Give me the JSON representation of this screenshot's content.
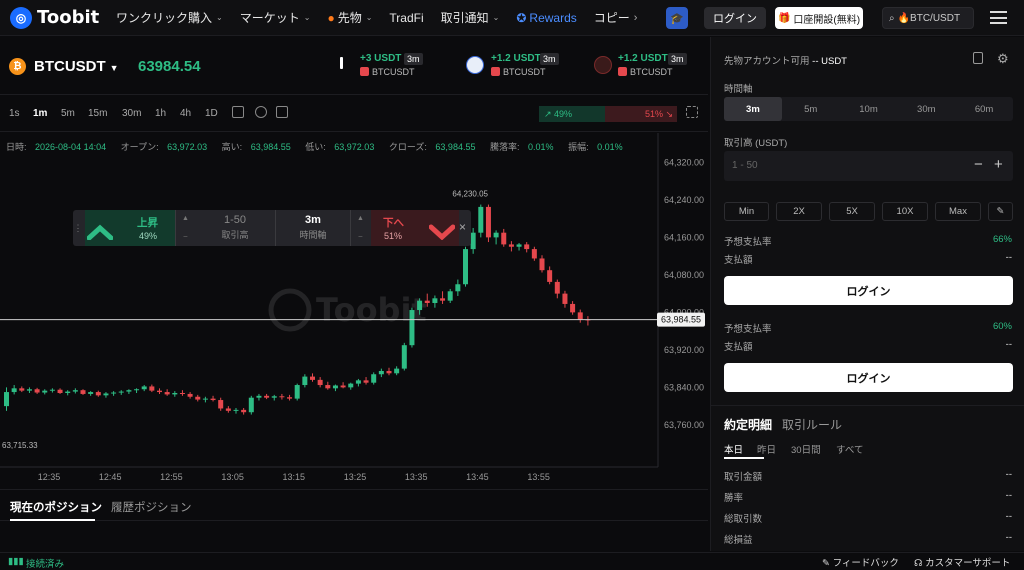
{
  "nav": {
    "logo": "Toobit",
    "items": [
      "ワンクリック購入",
      "マーケット",
      "先物",
      "TradFi",
      "取引通知",
      "Rewards",
      "コピー"
    ],
    "login": "ログイン",
    "open_account": "口座開設(無料)",
    "search": "🔥BTC/USDT"
  },
  "ticker": {
    "symbol": "BTCUSDT",
    "price": "63984.54",
    "trades": [
      {
        "amount": "+3 USDT",
        "dur": "3m",
        "sym": "BTCUSDT"
      },
      {
        "amount": "+1.2 USDT",
        "dur": "3m",
        "sym": "BTCUSDT"
      },
      {
        "amount": "+1.2 USDT",
        "dur": "3m",
        "sym": "BTCUSDT"
      }
    ]
  },
  "toolbar": {
    "timeframes": [
      "1s",
      "1m",
      "5m",
      "15m",
      "30m",
      "1h",
      "4h",
      "1D"
    ],
    "active": "1m",
    "up_pct": "↗ 49%",
    "down_pct": "51% ↘"
  },
  "info": {
    "date_label": "日時:",
    "date": "2026-08-04 14:04",
    "open_label": "オープン:",
    "open": "63,972.03",
    "high_label": "高い:",
    "high": "63,984.55",
    "low_label": "低い:",
    "low": "63,972.03",
    "close_label": "クローズ:",
    "close": "63,984.55",
    "change_label": "騰落率:",
    "change": "0.01%",
    "amp_label": "振幅:",
    "amp": "0.01%"
  },
  "chart_data": {
    "type": "candlestick",
    "y_ticks": [
      "64,320.00",
      "64,240.00",
      "64,160.00",
      "64,080.00",
      "64,000.00",
      "63,920.00",
      "63,840.00",
      "63,760.00"
    ],
    "x_ticks": [
      "12:35",
      "12:45",
      "12:55",
      "13:05",
      "13:15",
      "13:25",
      "13:35",
      "13:45",
      "13:55"
    ],
    "ylim": [
      63700,
      64340
    ],
    "current_price": "63,984.55",
    "high_annotation": "64,230.05",
    "low_annotation": "63,715.33",
    "watermark": "Toobit",
    "candles": [
      [
        63800,
        63840,
        63790,
        63830
      ],
      [
        63830,
        63845,
        63825,
        63838
      ],
      [
        63838,
        63842,
        63830,
        63833
      ],
      [
        63833,
        63840,
        63828,
        63836
      ],
      [
        63836,
        63839,
        63826,
        63829
      ],
      [
        63829,
        63836,
        63825,
        63833
      ],
      [
        63833,
        63838,
        63829,
        63835
      ],
      [
        63835,
        63838,
        63826,
        63828
      ],
      [
        63828,
        63834,
        63823,
        63831
      ],
      [
        63831,
        63838,
        63827,
        63834
      ],
      [
        63834,
        63836,
        63824,
        63826
      ],
      [
        63826,
        63832,
        63822,
        63830
      ],
      [
        63830,
        63833,
        63820,
        63823
      ],
      [
        63823,
        63830,
        63818,
        63827
      ],
      [
        63827,
        63832,
        63822,
        63829
      ],
      [
        63829,
        63834,
        63824,
        63831
      ],
      [
        63831,
        63836,
        63826,
        63834
      ],
      [
        63834,
        63838,
        63828,
        63836
      ],
      [
        63836,
        63845,
        63832,
        63842
      ],
      [
        63842,
        63846,
        63830,
        63833
      ],
      [
        63833,
        63838,
        63826,
        63830
      ],
      [
        63830,
        63836,
        63822,
        63825
      ],
      [
        63825,
        63832,
        63820,
        63828
      ],
      [
        63828,
        63834,
        63822,
        63826
      ],
      [
        63826,
        63830,
        63816,
        63820
      ],
      [
        63820,
        63824,
        63810,
        63814
      ],
      [
        63814,
        63820,
        63808,
        63816
      ],
      [
        63816,
        63822,
        63810,
        63813
      ],
      [
        63813,
        63818,
        63790,
        63795
      ],
      [
        63795,
        63800,
        63786,
        63790
      ],
      [
        63790,
        63796,
        63784,
        63792
      ],
      [
        63792,
        63796,
        63782,
        63787
      ],
      [
        63787,
        63822,
        63782,
        63818
      ],
      [
        63818,
        63826,
        63812,
        63822
      ],
      [
        63822,
        63826,
        63815,
        63818
      ],
      [
        63818,
        63824,
        63812,
        63821
      ],
      [
        63821,
        63826,
        63814,
        63819
      ],
      [
        63819,
        63824,
        63812,
        63816
      ],
      [
        63816,
        63848,
        63812,
        63845
      ],
      [
        63845,
        63868,
        63840,
        63863
      ],
      [
        63863,
        63870,
        63852,
        63856
      ],
      [
        63856,
        63862,
        63840,
        63845
      ],
      [
        63845,
        63852,
        63835,
        63838
      ],
      [
        63838,
        63846,
        63832,
        63844
      ],
      [
        63844,
        63851,
        63838,
        63840
      ],
      [
        63840,
        63850,
        63835,
        63848
      ],
      [
        63848,
        63858,
        63842,
        63855
      ],
      [
        63855,
        63862,
        63846,
        63850
      ],
      [
        63850,
        63872,
        63846,
        63868
      ],
      [
        63868,
        63880,
        63862,
        63875
      ],
      [
        63875,
        63882,
        63866,
        63870
      ],
      [
        63870,
        63885,
        63866,
        63880
      ],
      [
        63880,
        63935,
        63876,
        63930
      ],
      [
        63930,
        64010,
        63925,
        64005
      ],
      [
        64005,
        64030,
        63995,
        64025
      ],
      [
        64025,
        64040,
        64012,
        64020
      ],
      [
        64020,
        64036,
        64010,
        64030
      ],
      [
        64030,
        64045,
        64018,
        64025
      ],
      [
        64025,
        64050,
        64020,
        64045
      ],
      [
        64045,
        64070,
        64035,
        64060
      ],
      [
        64060,
        64140,
        64055,
        64135
      ],
      [
        64135,
        64180,
        64125,
        64170
      ],
      [
        64170,
        64230,
        64160,
        64225
      ],
      [
        64225,
        64230,
        64150,
        64160
      ],
      [
        64160,
        64175,
        64145,
        64170
      ],
      [
        64170,
        64178,
        64140,
        64145
      ],
      [
        64145,
        64152,
        64130,
        64140
      ],
      [
        64140,
        64148,
        64132,
        64145
      ],
      [
        64145,
        64150,
        64128,
        64135
      ],
      [
        64135,
        64140,
        64110,
        64115
      ],
      [
        64115,
        64122,
        64085,
        64090
      ],
      [
        64090,
        64098,
        64060,
        64065
      ],
      [
        64065,
        64070,
        64030,
        64040
      ],
      [
        64040,
        64046,
        64010,
        64018
      ],
      [
        64018,
        64024,
        63995,
        64000
      ],
      [
        64000,
        64006,
        63978,
        63985
      ],
      [
        63985,
        63992,
        63972,
        63984
      ]
    ]
  },
  "bet": {
    "up_label": "上昇",
    "up_pct": "49%",
    "amount_value": "1-50",
    "amount_label": "取引高",
    "time_value": "3m",
    "time_label": "時間軸",
    "down_label": "下へ",
    "down_pct": "51%"
  },
  "bottom": {
    "tab_current": "現在のポジション",
    "tab_history": "履歴ポジション"
  },
  "status": {
    "connected": "接続済み",
    "feedback": "フィードバック",
    "support": "カスタマーサポート"
  },
  "panel": {
    "account_label": "先物アカウント可用",
    "account_value": "-- USDT",
    "timeframe_label": "時間軸",
    "timeframes": [
      "3m",
      "5m",
      "10m",
      "30m",
      "60m"
    ],
    "amount_label": "取引高 (USDT)",
    "amount_placeholder": "1 - 50",
    "levels": [
      "Min",
      "2X",
      "5X",
      "10X",
      "Max"
    ],
    "up_rate_label": "予想支払率",
    "up_rate": "66%",
    "up_pay_label": "支払額",
    "up_pay": "--",
    "login": "ログイン",
    "down_rate_label": "予想支払率",
    "down_rate": "60%",
    "down_pay_label": "支払額",
    "down_pay": "--",
    "tab_detail": "約定明細",
    "tab_rules": "取引ルール",
    "periods": [
      "本日",
      "昨日",
      "30日間",
      "すべて"
    ],
    "stats": [
      {
        "label": "取引金額",
        "value": "--"
      },
      {
        "label": "勝率",
        "value": "--"
      },
      {
        "label": "総取引数",
        "value": "--"
      },
      {
        "label": "総損益",
        "value": "--"
      }
    ]
  },
  "colors": {
    "up": "#2ebd85",
    "down": "#e5484d",
    "accent": "#4b8dff"
  }
}
